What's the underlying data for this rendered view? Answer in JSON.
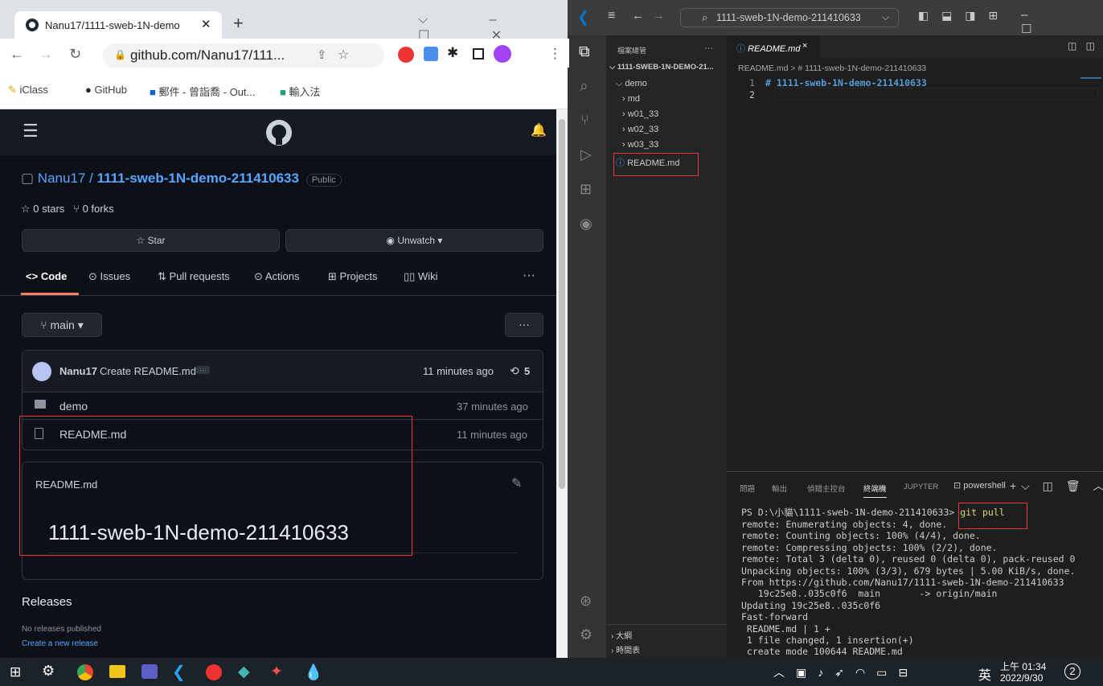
{
  "chrome": {
    "tab_title": "Nanu17/1111-sweb-1N-demo",
    "url": "github.com/Nanu17/111...",
    "bookmarks": [
      "iClass",
      "GitHub",
      "郵件 - 曾詣喬 - Out...",
      "輸入法"
    ]
  },
  "github": {
    "owner": "Nanu17",
    "slash": "/",
    "repo": "1111-sweb-1N-demo-211410633",
    "visibility": "Public",
    "stars": "0 stars",
    "forks": "0 forks",
    "star_label": "Star",
    "unwatch_label": "Unwatch",
    "nav_tabs": [
      "Code",
      "Issues",
      "Pull requests",
      "Actions",
      "Projects",
      "Wiki"
    ],
    "branch": "main",
    "commit": {
      "author": "Nanu17",
      "message": "Create README.md",
      "time": "11 minutes ago",
      "count": "5"
    },
    "files": [
      {
        "name": "demo",
        "type": "folder",
        "time": "37 minutes ago"
      },
      {
        "name": "README.md",
        "type": "file",
        "time": "11 minutes ago"
      }
    ],
    "readme_title": "README.md",
    "readme_heading": "1111-sweb-1N-demo-211410633",
    "releases_heading": "Releases",
    "no_releases": "No releases published",
    "create_release": "Create a new release"
  },
  "vscode": {
    "search": "1111-sweb-1N-demo-211410633",
    "explorer_title": "檔案總管",
    "explorer_dots": "···",
    "root": "1111-SWEB-1N-DEMO-21...",
    "tree": [
      "demo",
      "md",
      "w01_33",
      "w02_33",
      "w03_33",
      "README.md"
    ],
    "outline": "大綱",
    "timeline": "時間表",
    "editor_tab": "README.md",
    "breadcrumb": "README.md > # 1111-sweb-1N-demo-211410633",
    "line_numbers": [
      "1",
      "2"
    ],
    "code_line": "# 1111-sweb-1N-demo-211410633",
    "panel_tabs": [
      "問題",
      "輸出",
      "偵錯主控台",
      "終端機",
      "JUPYTER"
    ],
    "terminal_profile": "powershell",
    "prompt": "PS D:\\小貓\\1111-sweb-1N-demo-211410633>",
    "command": "git pull",
    "terminal_lines": [
      "remote: Enumerating objects: 4, done.",
      "remote: Counting objects: 100% (4/4), done.",
      "remote: Compressing objects: 100% (2/2), done.",
      "remote: Total 3 (delta 0), reused 0 (delta 0), pack-reused 0",
      "Unpacking objects: 100% (3/3), 679 bytes | 5.00 KiB/s, done.",
      "From https://github.com/Nanu17/1111-sweb-1N-demo-211410633",
      "   19c25e8..035c0f6  main       -> origin/main",
      "Updating 19c25e8..035c0f6",
      "Fast-forward",
      " README.md | 1 +",
      " 1 file changed, 1 insertion(+)",
      " create mode 100644 README.md"
    ]
  },
  "taskbar": {
    "ime": "英",
    "time": "上午 01:34",
    "date": "2022/9/30",
    "notifications": "2"
  },
  "colors": {
    "github_bg": "#0d1117",
    "link": "#58a6ff",
    "highlight": "#e5393d",
    "vscode_blue": "#0078d4"
  }
}
